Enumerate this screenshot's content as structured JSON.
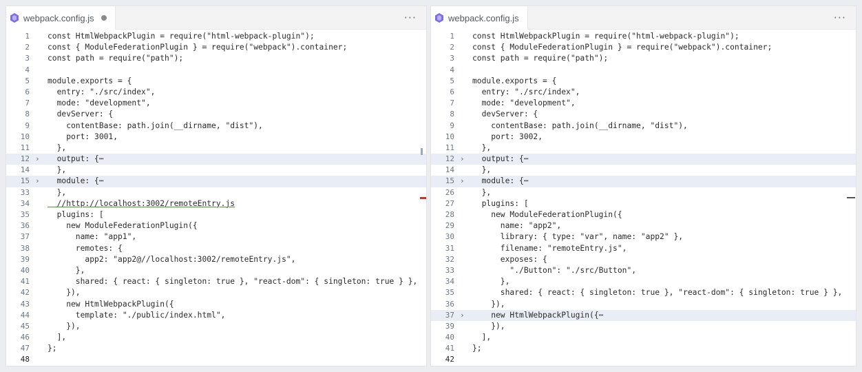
{
  "left": {
    "tab": {
      "title": "webpack.config.js",
      "dirty": true
    },
    "more": "···",
    "lines": [
      {
        "n": "1",
        "t": "const HtmlWebpackPlugin = require(\"html-webpack-plugin\");"
      },
      {
        "n": "2",
        "t": "const { ModuleFederationPlugin } = require(\"webpack\").container;"
      },
      {
        "n": "3",
        "t": "const path = require(\"path\");"
      },
      {
        "n": "4",
        "t": ""
      },
      {
        "n": "5",
        "t": "module.exports = {"
      },
      {
        "n": "6",
        "t": "  entry: \"./src/index\","
      },
      {
        "n": "7",
        "t": "  mode: \"development\","
      },
      {
        "n": "8",
        "t": "  devServer: {"
      },
      {
        "n": "9",
        "t": "    contentBase: path.join(__dirname, \"dist\"),"
      },
      {
        "n": "10",
        "t": "    port: 3001,"
      },
      {
        "n": "11",
        "t": "  },"
      },
      {
        "n": "12",
        "t": "  output: {⋯",
        "fold": true,
        "hl": true
      },
      {
        "n": "14",
        "t": "  },"
      },
      {
        "n": "15",
        "t": "  module: {⋯",
        "fold": true,
        "hl": true
      },
      {
        "n": "33",
        "t": "  },"
      },
      {
        "n": "34",
        "t": "  //http://localhost:3002/remoteEntry.js",
        "link": true
      },
      {
        "n": "35",
        "t": "  plugins: ["
      },
      {
        "n": "36",
        "t": "    new ModuleFederationPlugin({"
      },
      {
        "n": "37",
        "t": "      name: \"app1\","
      },
      {
        "n": "38",
        "t": "      remotes: {"
      },
      {
        "n": "39",
        "t": "        app2: \"app2@//localhost:3002/remoteEntry.js\","
      },
      {
        "n": "40",
        "t": "      },"
      },
      {
        "n": "41",
        "t": "      shared: { react: { singleton: true }, \"react-dom\": { singleton: true } },"
      },
      {
        "n": "42",
        "t": "    }),"
      },
      {
        "n": "43",
        "t": "    new HtmlWebpackPlugin({"
      },
      {
        "n": "44",
        "t": "      template: \"./public/index.html\","
      },
      {
        "n": "45",
        "t": "    }),"
      },
      {
        "n": "46",
        "t": "  ],"
      },
      {
        "n": "47",
        "t": "};"
      },
      {
        "n": "48",
        "t": "",
        "current": true
      }
    ]
  },
  "right": {
    "tab": {
      "title": "webpack.config.js",
      "dirty": false
    },
    "more": "···",
    "lines": [
      {
        "n": "1",
        "t": "const HtmlWebpackPlugin = require(\"html-webpack-plugin\");"
      },
      {
        "n": "2",
        "t": "const { ModuleFederationPlugin } = require(\"webpack\").container;"
      },
      {
        "n": "3",
        "t": "const path = require(\"path\");"
      },
      {
        "n": "4",
        "t": ""
      },
      {
        "n": "5",
        "t": "module.exports = {"
      },
      {
        "n": "6",
        "t": "  entry: \"./src/index\","
      },
      {
        "n": "7",
        "t": "  mode: \"development\","
      },
      {
        "n": "8",
        "t": "  devServer: {"
      },
      {
        "n": "9",
        "t": "    contentBase: path.join(__dirname, \"dist\"),"
      },
      {
        "n": "10",
        "t": "    port: 3002,"
      },
      {
        "n": "11",
        "t": "  },"
      },
      {
        "n": "12",
        "t": "  output: {⋯",
        "fold": true,
        "hl": true
      },
      {
        "n": "14",
        "t": "  },"
      },
      {
        "n": "15",
        "t": "  module: {⋯",
        "fold": true,
        "hl": true
      },
      {
        "n": "26",
        "t": "  },"
      },
      {
        "n": "27",
        "t": "  plugins: ["
      },
      {
        "n": "28",
        "t": "    new ModuleFederationPlugin({"
      },
      {
        "n": "29",
        "t": "      name: \"app2\","
      },
      {
        "n": "30",
        "t": "      library: { type: \"var\", name: \"app2\" },"
      },
      {
        "n": "31",
        "t": "      filename: \"remoteEntry.js\","
      },
      {
        "n": "32",
        "t": "      exposes: {"
      },
      {
        "n": "33",
        "t": "        \"./Button\": \"./src/Button\","
      },
      {
        "n": "34",
        "t": "      },"
      },
      {
        "n": "35",
        "t": "      shared: { react: { singleton: true }, \"react-dom\": { singleton: true } },"
      },
      {
        "n": "36",
        "t": "    }),"
      },
      {
        "n": "37",
        "t": "    new HtmlWebpackPlugin({⋯",
        "fold": true,
        "hl": true
      },
      {
        "n": "39",
        "t": "    }),"
      },
      {
        "n": "40",
        "t": "  ],"
      },
      {
        "n": "41",
        "t": "};"
      },
      {
        "n": "42",
        "t": "",
        "current": true
      }
    ]
  },
  "colors": {
    "accent": "#6f5bd8",
    "fold_highlight": "#e9edf6",
    "link_underline": "#4a9b2b",
    "error_marker": "#c0392b"
  }
}
